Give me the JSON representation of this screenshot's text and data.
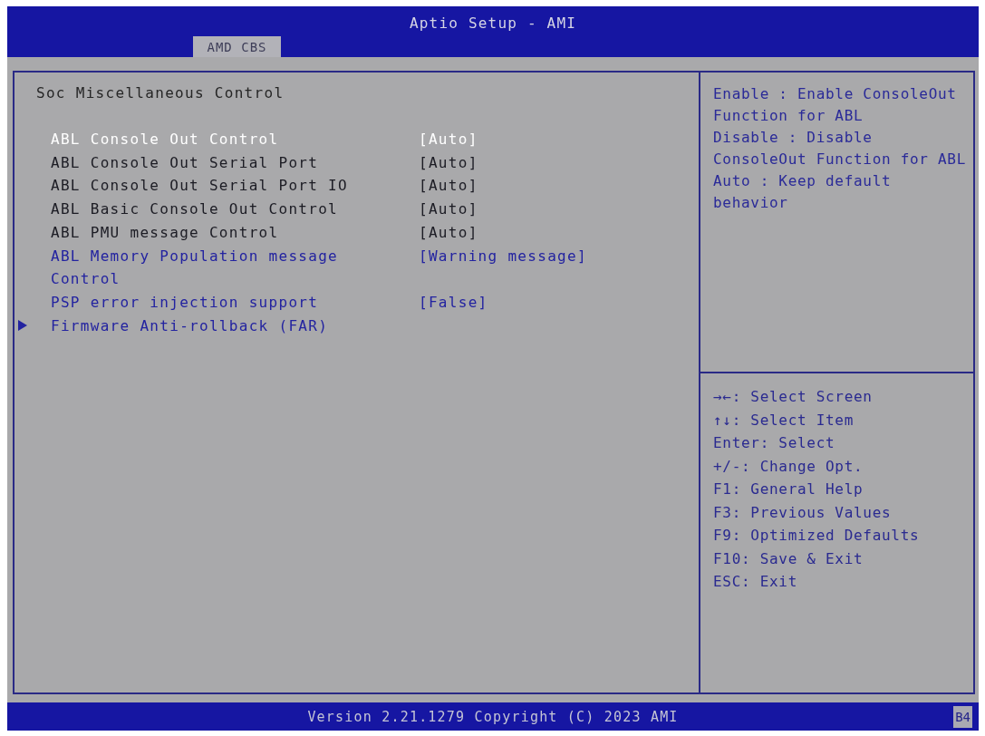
{
  "window": {
    "title": "Aptio Setup - AMI"
  },
  "tabs": [
    {
      "label": "AMD CBS",
      "selected": true
    }
  ],
  "page_title": "Soc Miscellaneous Control",
  "items": [
    {
      "kind": "setting",
      "label": "ABL Console Out Control",
      "value": "[Auto]",
      "selected": true,
      "disabled": false
    },
    {
      "kind": "setting",
      "label": "ABL Console Out Serial Port",
      "value": "[Auto]",
      "selected": false,
      "disabled": true
    },
    {
      "kind": "setting",
      "label": "ABL Console Out Serial Port IO",
      "value": "[Auto]",
      "selected": false,
      "disabled": true
    },
    {
      "kind": "setting",
      "label": "ABL Basic Console Out Control",
      "value": "[Auto]",
      "selected": false,
      "disabled": true
    },
    {
      "kind": "setting",
      "label": "ABL PMU message Control",
      "value": "[Auto]",
      "selected": false,
      "disabled": true
    },
    {
      "kind": "setting",
      "label": "ABL Memory Population message Control",
      "value": "[Warning message]",
      "selected": false,
      "disabled": false
    },
    {
      "kind": "setting",
      "label": "PSP error injection support",
      "value": "[False]",
      "selected": false,
      "disabled": false
    },
    {
      "kind": "submenu",
      "label": "Firmware Anti-rollback (FAR)",
      "selected": false,
      "disabled": false
    }
  ],
  "help": [
    "Enable : Enable ConsoleOut Function for ABL",
    "Disable : Disable ConsoleOut Function for ABL",
    "Auto : Keep default behavior"
  ],
  "key_help": [
    "→←: Select Screen",
    "↑↓: Select Item",
    "Enter: Select",
    "+/-: Change Opt.",
    "F1: General Help",
    "F3: Previous Values",
    "F9: Optimized Defaults",
    "F10: Save & Exit",
    "ESC: Exit"
  ],
  "status_bar": {
    "text": "Version 2.21.1279 Copyright (C) 2023 AMI",
    "code": "B4"
  }
}
